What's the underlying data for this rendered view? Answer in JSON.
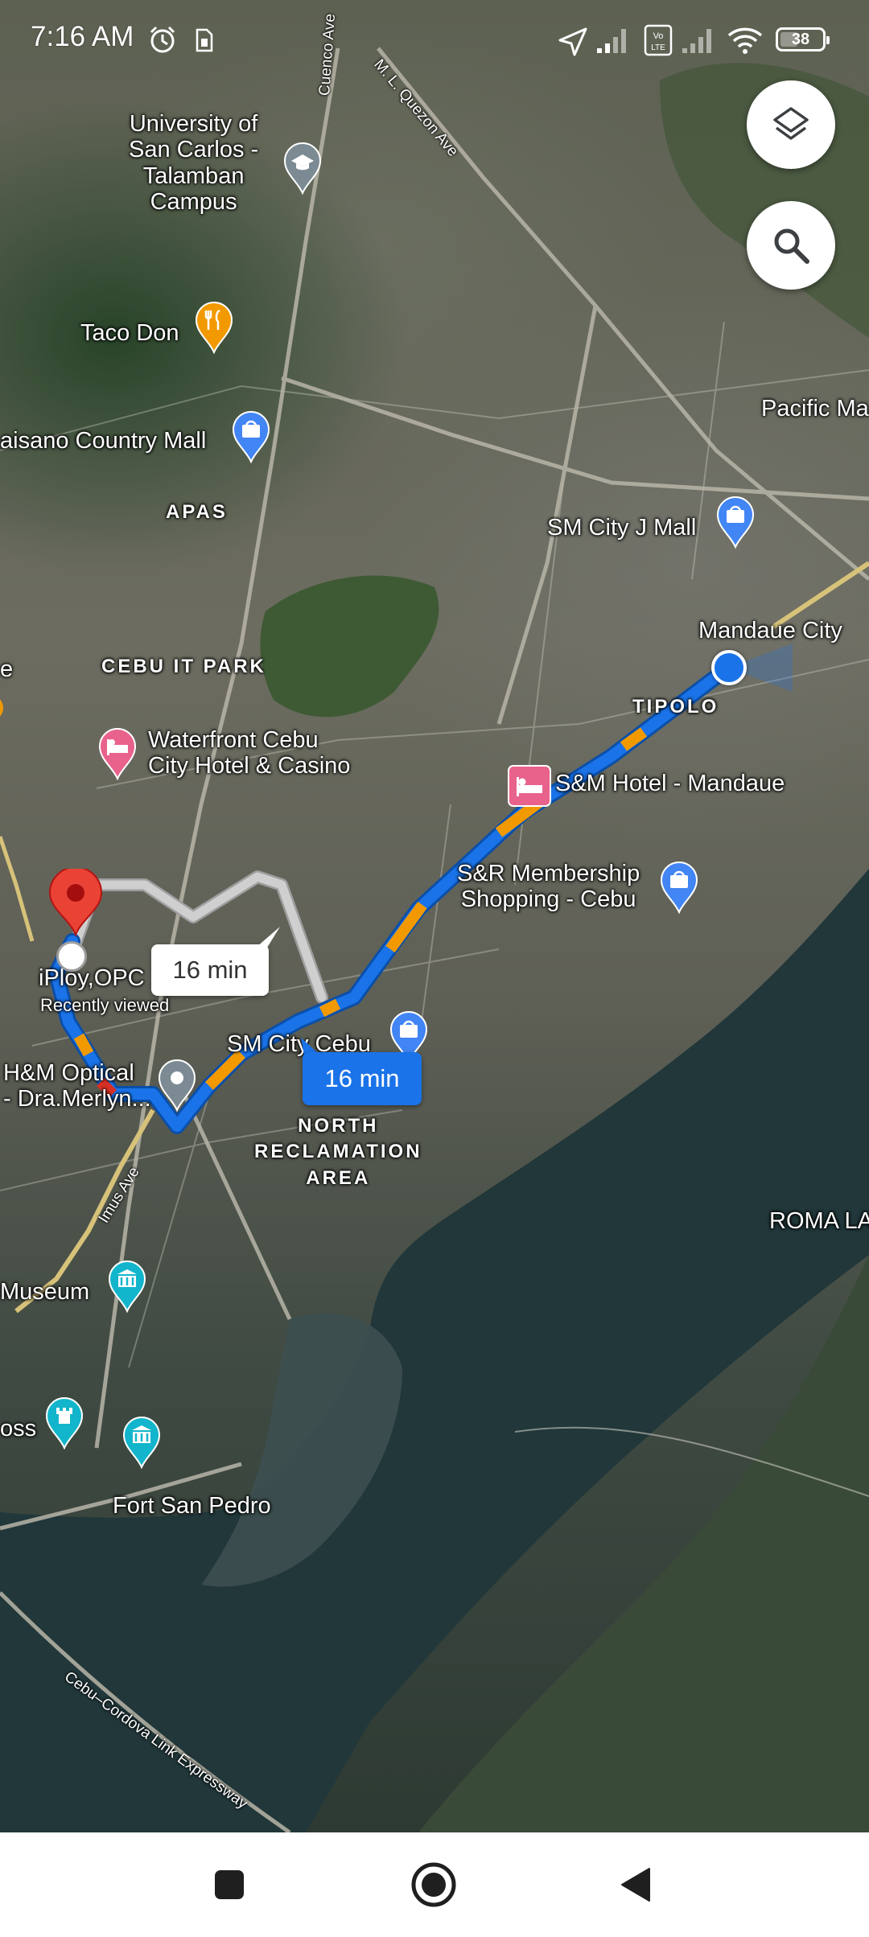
{
  "status_bar": {
    "time": "7:16 AM",
    "battery_level": "38",
    "icons": [
      "alarm-icon",
      "sim-card-icon",
      "location-arrow-icon",
      "signal-icon",
      "volte-icon",
      "signal-icon",
      "wifi-icon",
      "battery-icon"
    ]
  },
  "map": {
    "labels": {
      "university": "University of\nSan Carlos -\nTalamban\nCampus",
      "taco_don": "Taco Don",
      "gaisano": "aisano Country Mall",
      "apas": "APAS",
      "pacific": "Pacific Ma",
      "sm_j_mall": "SM City J Mall",
      "mandaue_city": "Mandaue City",
      "cebu_it_park": "CEBU IT PARK",
      "tipolo": "TIPOLO",
      "waterfront": "Waterfront Cebu\nCity Hotel & Casino",
      "sm_hotel": "S&M Hotel - Mandaue",
      "sr_membership": "S&R Membership\nShopping - Cebu",
      "iploy": "iPloy,OPC",
      "recently_viewed": "Recently viewed",
      "hm_optical": "H&M Optical\n- Dra.Merlyn...",
      "sm_city_cebu": "SM City Cebu",
      "north_reclamation": "NORTH\nRECLAMATION\nAREA",
      "roma": "ROMA LA",
      "museum": "Museum",
      "oss": "oss",
      "fort_san_pedro": "Fort San Pedro",
      "left_e": "e"
    },
    "roads": {
      "cuenco": "Cuenco Ave",
      "quezon": "M. L. Quezon Ave",
      "imus": "Imus Ave",
      "cordova": "Cebu–Cordova Link Expressway"
    },
    "route_chips": {
      "alternate": "16 min",
      "primary": "16 min"
    },
    "colors": {
      "route_blue": "#1a73e8",
      "traffic_orange": "#f29900",
      "traffic_red": "#d93025",
      "alt_route": "#bdbdbd",
      "destination_pin": "#ea4335"
    }
  },
  "fabs": {
    "layers": "layers-icon",
    "search": "search-icon"
  },
  "nav_bar": {
    "buttons": [
      "recent-apps-icon",
      "home-icon",
      "back-icon"
    ]
  }
}
